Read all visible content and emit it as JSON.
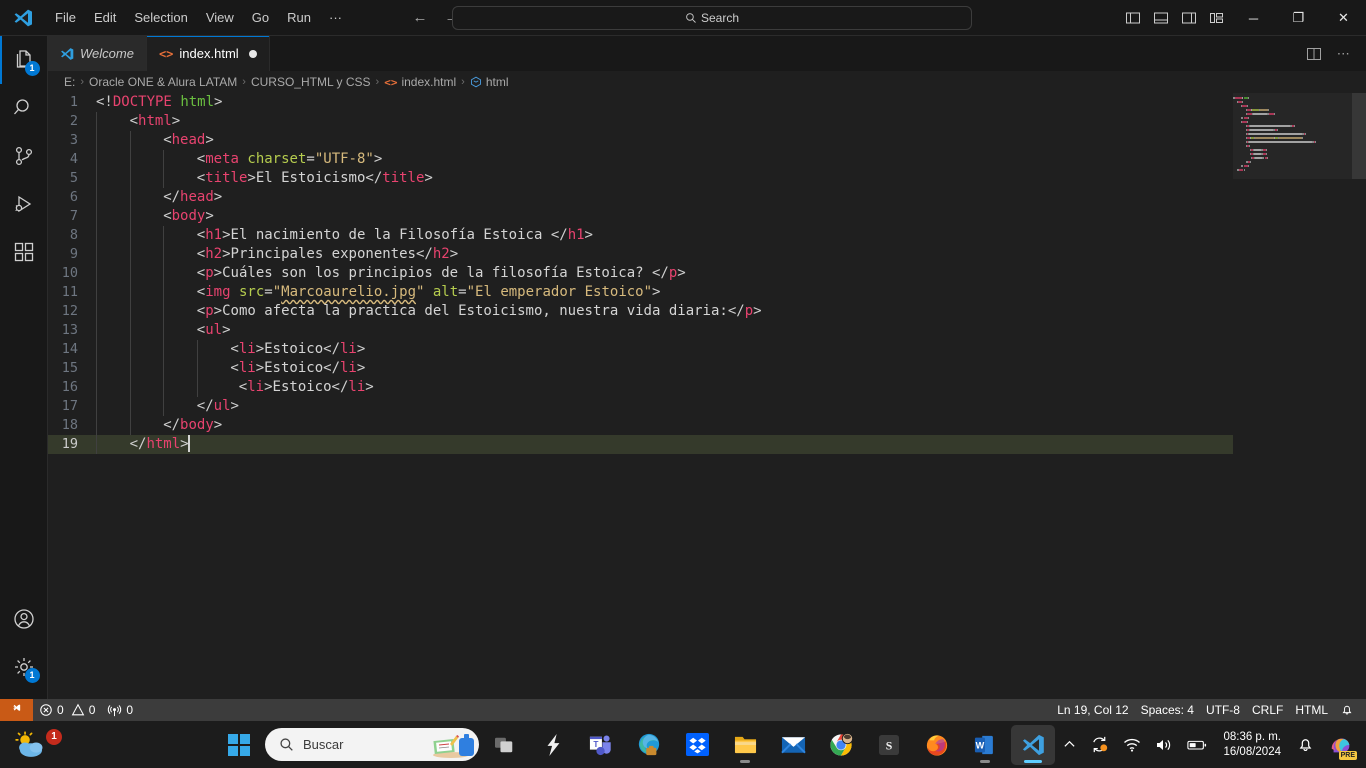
{
  "titlebar": {
    "logo_icon": "vscode-logo-icon",
    "menus": [
      {
        "label": "File",
        "name": "menu-file"
      },
      {
        "label": "Edit",
        "name": "menu-edit"
      },
      {
        "label": "Selection",
        "name": "menu-selection"
      },
      {
        "label": "View",
        "name": "menu-view"
      },
      {
        "label": "Go",
        "name": "menu-go"
      },
      {
        "label": "Run",
        "name": "menu-run"
      },
      {
        "label": "···",
        "name": "menu-more"
      }
    ],
    "back_icon": "arrow-left-icon",
    "forward_icon": "arrow-right-icon",
    "search_placeholder": "Search",
    "search_icon": "search-icon",
    "layout_buttons": [
      {
        "name": "toggle-primary-sidebar-button"
      },
      {
        "name": "toggle-panel-button"
      },
      {
        "name": "toggle-secondary-sidebar-button"
      },
      {
        "name": "customize-layout-button"
      }
    ],
    "window_controls": {
      "minimize": "─",
      "maximize": "❐",
      "close": "✕"
    }
  },
  "activitybar": {
    "items": [
      {
        "name": "activitybar-explorer",
        "icon": "files-icon",
        "badge": "1",
        "active": true
      },
      {
        "name": "activitybar-search",
        "icon": "search-icon",
        "badge": "",
        "active": false
      },
      {
        "name": "activitybar-source-control",
        "icon": "source-control-icon",
        "badge": "",
        "active": false
      },
      {
        "name": "activitybar-run-debug",
        "icon": "run-debug-icon",
        "badge": "",
        "active": false
      },
      {
        "name": "activitybar-extensions",
        "icon": "extensions-icon",
        "badge": "",
        "active": false
      }
    ],
    "bottom": [
      {
        "name": "activitybar-accounts",
        "icon": "account-icon",
        "badge": ""
      },
      {
        "name": "activitybar-settings",
        "icon": "gear-icon",
        "badge": "1"
      }
    ]
  },
  "tabs": [
    {
      "label": "Welcome",
      "icon": "vscode-logo-icon",
      "active": false,
      "dirty": false
    },
    {
      "label": "index.html",
      "icon": "html-file-icon",
      "active": true,
      "dirty": true
    }
  ],
  "tabbar_actions": [
    {
      "name": "split-editor-right-button",
      "icon": "split-editor-icon"
    },
    {
      "name": "editor-more-actions-button",
      "icon": "ellipsis-icon"
    }
  ],
  "breadcrumb": {
    "segments": [
      {
        "label": "E:",
        "icon": ""
      },
      {
        "label": "Oracle ONE & Alura LATAM",
        "icon": ""
      },
      {
        "label": "CURSO_HTML y CSS",
        "icon": ""
      },
      {
        "label": "index.html",
        "icon": "html-file-icon"
      },
      {
        "label": "html",
        "icon": "symbol-field-icon"
      }
    ],
    "separator": "›"
  },
  "editor": {
    "active_line": 19,
    "cursor_line": 19,
    "language": "html",
    "lines": [
      {
        "n": 1,
        "indent": 0,
        "tokens": [
          {
            "t": "brack",
            "v": "<!"
          },
          {
            "t": "doct",
            "v": "DOCTYPE"
          },
          {
            "t": "text",
            "v": " "
          },
          {
            "t": "doctv",
            "v": "html"
          },
          {
            "t": "brack",
            "v": ">"
          }
        ]
      },
      {
        "n": 2,
        "indent": 1,
        "tokens": [
          {
            "t": "brack",
            "v": "<"
          },
          {
            "t": "tag",
            "v": "html"
          },
          {
            "t": "brack",
            "v": ">"
          }
        ]
      },
      {
        "n": 3,
        "indent": 2,
        "tokens": [
          {
            "t": "brack",
            "v": "<"
          },
          {
            "t": "tag",
            "v": "head"
          },
          {
            "t": "brack",
            "v": ">"
          }
        ]
      },
      {
        "n": 4,
        "indent": 3,
        "tokens": [
          {
            "t": "brack",
            "v": "<"
          },
          {
            "t": "tag",
            "v": "meta"
          },
          {
            "t": "text",
            "v": " "
          },
          {
            "t": "attr",
            "v": "charset"
          },
          {
            "t": "brack",
            "v": "="
          },
          {
            "t": "val",
            "v": "\"UTF-8\""
          },
          {
            "t": "brack",
            "v": ">"
          }
        ]
      },
      {
        "n": 5,
        "indent": 3,
        "tokens": [
          {
            "t": "brack",
            "v": "<"
          },
          {
            "t": "tag",
            "v": "title"
          },
          {
            "t": "brack",
            "v": ">"
          },
          {
            "t": "text",
            "v": "El Estoicismo"
          },
          {
            "t": "brack",
            "v": "</"
          },
          {
            "t": "tag",
            "v": "title"
          },
          {
            "t": "brack",
            "v": ">"
          }
        ]
      },
      {
        "n": 6,
        "indent": 2,
        "tokens": [
          {
            "t": "brack",
            "v": "</"
          },
          {
            "t": "tag",
            "v": "head"
          },
          {
            "t": "brack",
            "v": ">"
          }
        ]
      },
      {
        "n": 7,
        "indent": 2,
        "tokens": [
          {
            "t": "brack",
            "v": "<"
          },
          {
            "t": "tag",
            "v": "body"
          },
          {
            "t": "brack",
            "v": ">"
          }
        ]
      },
      {
        "n": 8,
        "indent": 3,
        "tokens": [
          {
            "t": "brack",
            "v": "<"
          },
          {
            "t": "tag",
            "v": "h1"
          },
          {
            "t": "brack",
            "v": ">"
          },
          {
            "t": "text",
            "v": "El nacimiento de la Filosofía Estoica "
          },
          {
            "t": "brack",
            "v": "</"
          },
          {
            "t": "tag",
            "v": "h1"
          },
          {
            "t": "brack",
            "v": ">"
          }
        ]
      },
      {
        "n": 9,
        "indent": 3,
        "tokens": [
          {
            "t": "brack",
            "v": "<"
          },
          {
            "t": "tag",
            "v": "h2"
          },
          {
            "t": "brack",
            "v": ">"
          },
          {
            "t": "text",
            "v": "Principales exponentes"
          },
          {
            "t": "brack",
            "v": "</"
          },
          {
            "t": "tag",
            "v": "h2"
          },
          {
            "t": "brack",
            "v": ">"
          }
        ]
      },
      {
        "n": 10,
        "indent": 3,
        "tokens": [
          {
            "t": "brack",
            "v": "<"
          },
          {
            "t": "tag",
            "v": "p"
          },
          {
            "t": "brack",
            "v": ">"
          },
          {
            "t": "text",
            "v": "Cuáles son los principios de la filosofía Estoica? "
          },
          {
            "t": "brack",
            "v": "</"
          },
          {
            "t": "tag",
            "v": "p"
          },
          {
            "t": "brack",
            "v": ">"
          }
        ]
      },
      {
        "n": 11,
        "indent": 3,
        "tokens": [
          {
            "t": "brack",
            "v": "<"
          },
          {
            "t": "tag",
            "v": "img"
          },
          {
            "t": "text",
            "v": " "
          },
          {
            "t": "attr",
            "v": "src"
          },
          {
            "t": "brack",
            "v": "="
          },
          {
            "t": "val",
            "v": "\""
          },
          {
            "t": "val-err",
            "v": "Marcoaurelio.jpg"
          },
          {
            "t": "val",
            "v": "\""
          },
          {
            "t": "text",
            "v": " "
          },
          {
            "t": "attr",
            "v": "alt"
          },
          {
            "t": "brack",
            "v": "="
          },
          {
            "t": "val",
            "v": "\"El emperador Estoico\""
          },
          {
            "t": "brack",
            "v": ">"
          }
        ]
      },
      {
        "n": 12,
        "indent": 3,
        "tokens": [
          {
            "t": "brack",
            "v": "<"
          },
          {
            "t": "tag",
            "v": "p"
          },
          {
            "t": "brack",
            "v": ">"
          },
          {
            "t": "text",
            "v": "Como afecta la practica del Estoicismo, nuestra vida diaria:"
          },
          {
            "t": "brack",
            "v": "</"
          },
          {
            "t": "tag",
            "v": "p"
          },
          {
            "t": "brack",
            "v": ">"
          }
        ]
      },
      {
        "n": 13,
        "indent": 3,
        "tokens": [
          {
            "t": "brack",
            "v": "<"
          },
          {
            "t": "tag",
            "v": "ul"
          },
          {
            "t": "brack",
            "v": ">"
          }
        ]
      },
      {
        "n": 14,
        "indent": 4,
        "tokens": [
          {
            "t": "brack",
            "v": "<"
          },
          {
            "t": "tag",
            "v": "li"
          },
          {
            "t": "brack",
            "v": ">"
          },
          {
            "t": "text",
            "v": "Estoico"
          },
          {
            "t": "brack",
            "v": "</"
          },
          {
            "t": "tag",
            "v": "li"
          },
          {
            "t": "brack",
            "v": ">"
          }
        ]
      },
      {
        "n": 15,
        "indent": 4,
        "tokens": [
          {
            "t": "brack",
            "v": "<"
          },
          {
            "t": "tag",
            "v": "li"
          },
          {
            "t": "brack",
            "v": ">"
          },
          {
            "t": "text",
            "v": "Estoico"
          },
          {
            "t": "brack",
            "v": "</"
          },
          {
            "t": "tag",
            "v": "li"
          },
          {
            "t": "brack",
            "v": ">"
          }
        ]
      },
      {
        "n": 16,
        "indent": 4,
        "extra_space": 1,
        "tokens": [
          {
            "t": "brack",
            "v": "<"
          },
          {
            "t": "tag",
            "v": "li"
          },
          {
            "t": "brack",
            "v": ">"
          },
          {
            "t": "text",
            "v": "Estoico"
          },
          {
            "t": "brack",
            "v": "</"
          },
          {
            "t": "tag",
            "v": "li"
          },
          {
            "t": "brack",
            "v": ">"
          }
        ]
      },
      {
        "n": 17,
        "indent": 3,
        "tokens": [
          {
            "t": "brack",
            "v": "</"
          },
          {
            "t": "tag",
            "v": "ul"
          },
          {
            "t": "brack",
            "v": ">"
          }
        ]
      },
      {
        "n": 18,
        "indent": 2,
        "tokens": [
          {
            "t": "brack",
            "v": "</"
          },
          {
            "t": "tag",
            "v": "body"
          },
          {
            "t": "brack",
            "v": ">"
          }
        ]
      },
      {
        "n": 19,
        "indent": 1,
        "cursor": true,
        "tokens": [
          {
            "t": "brack",
            "v": "</"
          },
          {
            "t": "tag",
            "v": "html"
          },
          {
            "t": "brack",
            "v": ">"
          }
        ]
      }
    ]
  },
  "statusbar": {
    "remote_icon": "remote-window-icon",
    "left": [
      {
        "name": "status-problems",
        "icon": "error-icon",
        "label": "0",
        "icon2": "warning-icon",
        "label2": "0"
      },
      {
        "name": "status-ports",
        "icon": "ports-icon",
        "label": "0"
      }
    ],
    "errors": "0",
    "warnings": "0",
    "ports": "0",
    "right": [
      {
        "name": "status-cursor-position",
        "label": "Ln 19, Col 12"
      },
      {
        "name": "status-indentation",
        "label": "Spaces: 4"
      },
      {
        "name": "status-encoding",
        "label": "UTF-8"
      },
      {
        "name": "status-eol",
        "label": "CRLF"
      },
      {
        "name": "status-language-mode",
        "label": "HTML"
      },
      {
        "name": "status-notifications",
        "label": "",
        "icon": "bell-icon"
      }
    ]
  },
  "taskbar": {
    "weather": {
      "name": "weather-widget",
      "badge": "1",
      "icon": "weather-cloud-sun-icon"
    },
    "start_icon": "windows-start-icon",
    "search": {
      "placeholder": "Buscar",
      "icon": "search-icon"
    },
    "apps": [
      {
        "name": "taskbar-task-view",
        "icon": "task-view-icon",
        "running": false,
        "active": false
      },
      {
        "name": "taskbar-opera",
        "icon": "opera-lightning-icon",
        "running": false,
        "active": false
      },
      {
        "name": "taskbar-teams",
        "icon": "teams-icon",
        "running": false,
        "active": false
      },
      {
        "name": "taskbar-edge",
        "icon": "edge-icon",
        "running": false,
        "active": false
      },
      {
        "name": "taskbar-dropbox",
        "icon": "dropbox-icon",
        "running": false,
        "active": false
      },
      {
        "name": "taskbar-file-explorer",
        "icon": "folder-icon",
        "running": true,
        "active": false
      },
      {
        "name": "taskbar-mail",
        "icon": "mail-icon",
        "running": false,
        "active": false
      },
      {
        "name": "taskbar-chrome",
        "icon": "chrome-icon",
        "running": false,
        "active": false
      },
      {
        "name": "taskbar-sublime",
        "icon": "s-app-icon",
        "running": false,
        "active": false
      },
      {
        "name": "taskbar-firefox",
        "icon": "firefox-icon",
        "running": false,
        "active": false
      },
      {
        "name": "taskbar-word",
        "icon": "word-icon",
        "running": true,
        "active": false
      },
      {
        "name": "taskbar-vscode",
        "icon": "vscode-logo-icon",
        "running": true,
        "active": true
      }
    ],
    "tray": {
      "overflow_icon": "chevron-up-icon",
      "update_icon": "sync-update-icon",
      "wifi_icon": "wifi-icon",
      "volume_icon": "volume-icon",
      "battery_icon": "battery-icon",
      "time": "08:36 p. m.",
      "date": "16/08/2024",
      "notification_icon": "bell-icon",
      "copilot_icon": "copilot-icon",
      "copilot_badge": "PRE"
    }
  },
  "colors": {
    "accent": "#0078d4",
    "remote_bg": "#c95a16",
    "tag": "#e8436f",
    "attr": "#b5cc4e",
    "value": "#d7ba7d",
    "doctype_value": "#6abf40",
    "active_line": "#353a2b"
  }
}
